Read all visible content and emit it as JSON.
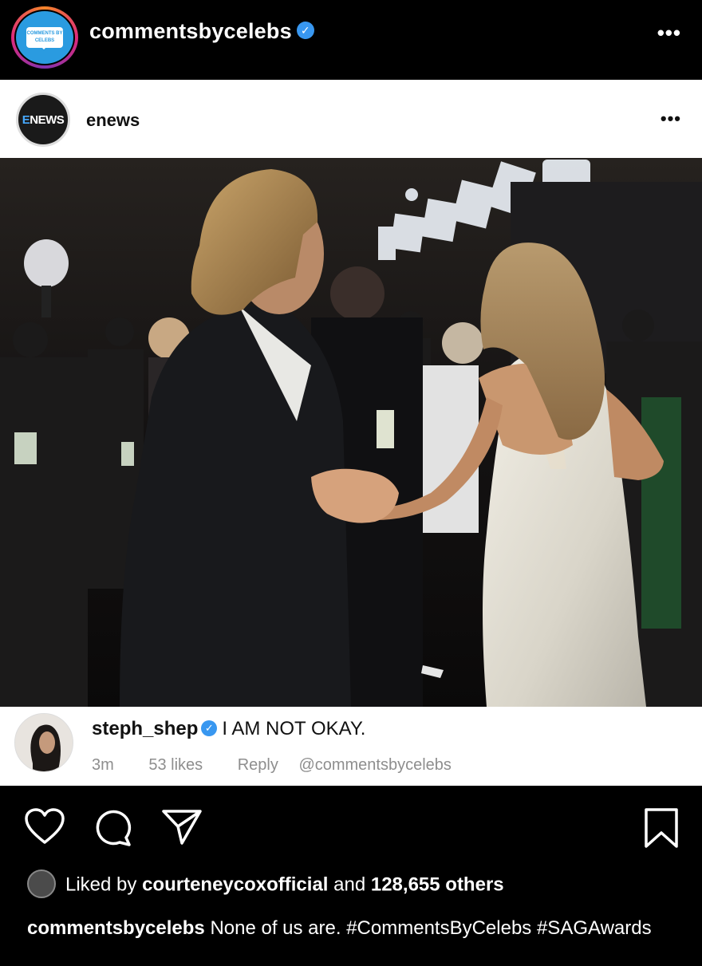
{
  "header": {
    "username": "commentsbycelebs",
    "avatar_text": "COMMENTS BY CELEBS",
    "more_label": "•••"
  },
  "post": {
    "username": "enews",
    "avatar_text_e": "E",
    "avatar_text_news": "NEWS",
    "more_label": "•••"
  },
  "comment": {
    "username": "steph_shep",
    "text": "I AM NOT OKAY.",
    "time": "3m",
    "likes": "53 likes",
    "reply": "Reply",
    "watermark": "@commentsbycelebs"
  },
  "footer": {
    "liked_prefix": "Liked by",
    "liked_user": "courteneycoxofficial",
    "liked_and": "and",
    "liked_count": "128,655 others",
    "caption_user": "commentsbycelebs",
    "caption_text": "None of us are. #CommentsByCelebs #SAGAwards"
  },
  "icons": [
    "heart-icon",
    "comment-icon",
    "share-icon",
    "bookmark-icon",
    "more-icon",
    "verified-icon"
  ],
  "colors": {
    "verified": "#3897f0",
    "background": "#000000",
    "card": "#ffffff",
    "meta": "#8e8e8e"
  }
}
